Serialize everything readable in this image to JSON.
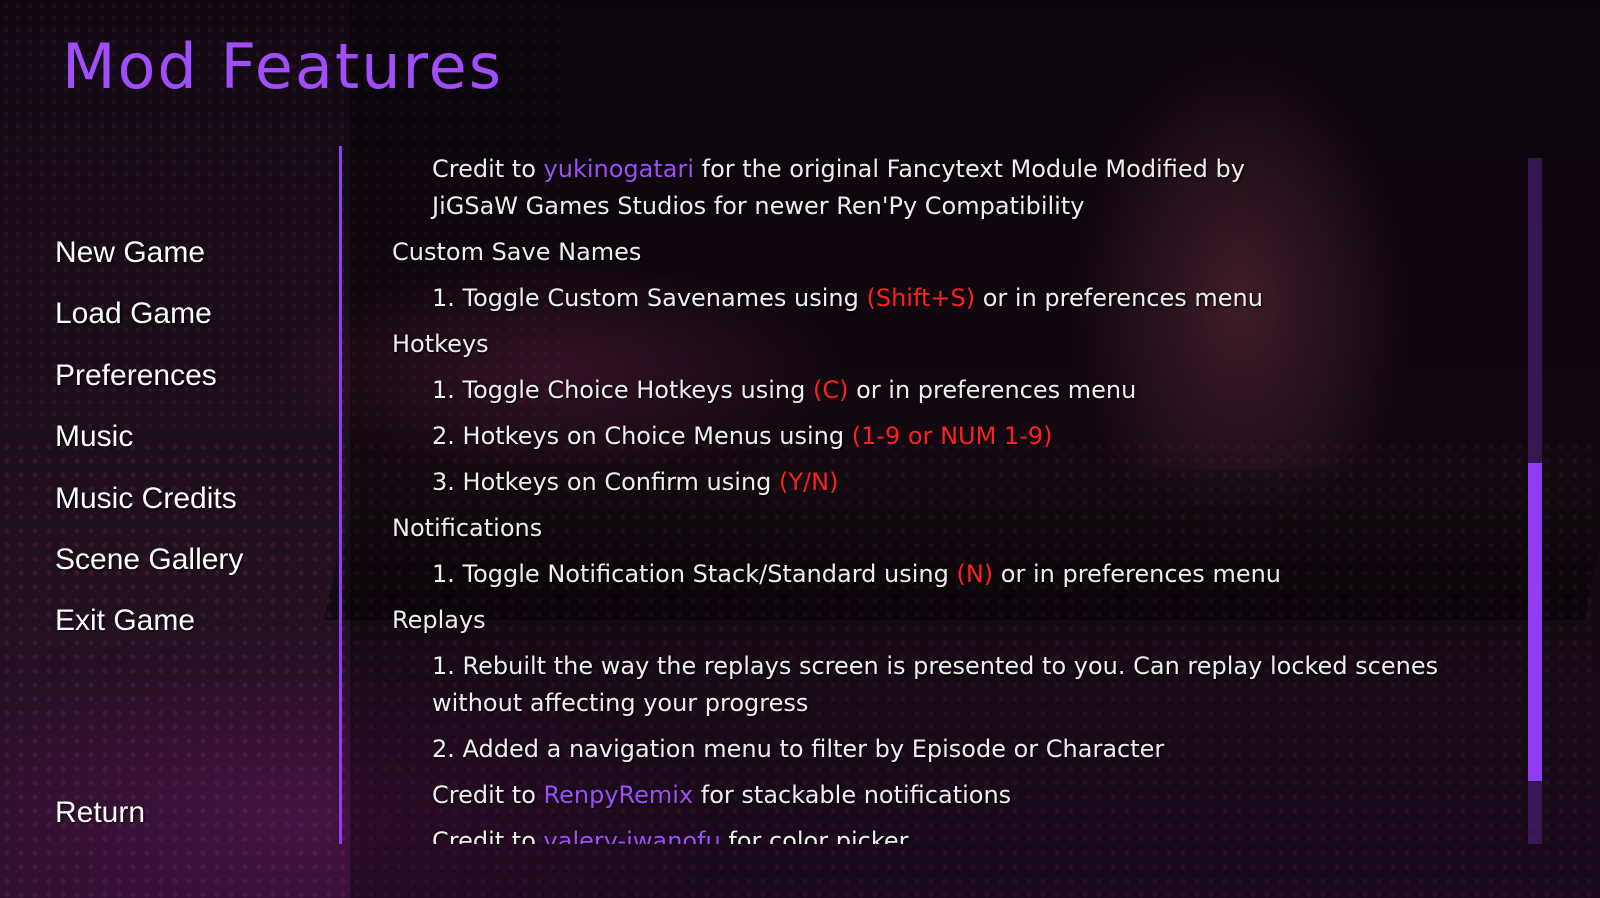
{
  "title": "Mod Features",
  "nav": {
    "new_game": "New Game",
    "load_game": "Load Game",
    "preferences": "Preferences",
    "music": "Music",
    "music_credits": "Music Credits",
    "scene_gallery": "Scene Gallery",
    "exit_game": "Exit Game",
    "return": "Return"
  },
  "content": {
    "credit_fancytext": {
      "pre": "Credit to ",
      "link": "yukinogatari",
      "post": " for the original Fancytext Module Modified by",
      "line2": "JiGSaW Games Studios for newer Ren'Py Compatibility"
    },
    "custom_save_names": {
      "heading": "Custom Save Names",
      "item1_pre": "1. Toggle Custom Savenames using ",
      "item1_key": "(Shift+S)",
      "item1_post": " or in preferences menu"
    },
    "hotkeys": {
      "heading": "Hotkeys",
      "item1_pre": "1. Toggle Choice Hotkeys using ",
      "item1_key": "(C)",
      "item1_post": " or in preferences menu",
      "item2_pre": "2. Hotkeys on Choice Menus using ",
      "item2_key": "(1-9 or NUM 1-9)",
      "item3_pre": "3. Hotkeys on Confirm using ",
      "item3_key": "(Y/N)"
    },
    "notifications": {
      "heading": "Notifications",
      "item1_pre": "1. Toggle Notification Stack/Standard using ",
      "item1_key": "(N)",
      "item1_post": " or in preferences menu"
    },
    "replays": {
      "heading": "Replays",
      "item1": "1. Rebuilt the way the replays screen is presented to you. Can replay locked scenes without affecting your progress",
      "item2": "2. Added a navigation menu to filter by Episode or Character"
    },
    "credit_renpyremix": {
      "pre": "Credit to ",
      "link": "RenpyRemix",
      "post": " for stackable notifications"
    },
    "credit_valery": {
      "pre": "Credit to ",
      "link": "valery-iwanofu",
      "post": " for color picker"
    }
  },
  "colors": {
    "accent": "#a04dfa",
    "highlight": "#ff2020",
    "text": "#eeeeee"
  },
  "scroll": {
    "position_fraction": 0.44,
    "visible_fraction": 0.46
  }
}
